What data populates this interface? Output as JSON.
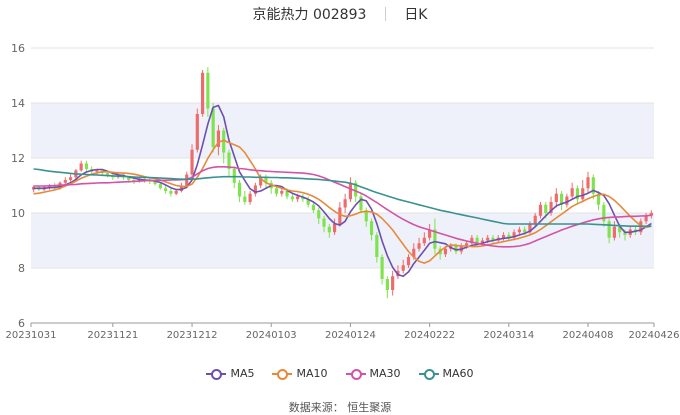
{
  "header": {
    "stock_label": "京能热力 002893",
    "period_label": "日K"
  },
  "source_text": "数据来源： 恒生聚源",
  "colors": {
    "up": "#ee6b6b",
    "down": "#7ee34c",
    "ma5": "#6d4fb0",
    "ma10": "#e8893a",
    "ma30": "#d353a6",
    "ma60": "#3a9190",
    "band": "#eef1f9"
  },
  "chart_data": {
    "type": "candlestick",
    "title": "",
    "xlabel": "",
    "ylabel": "",
    "ylim": [
      6,
      16
    ],
    "yticks": [
      6,
      8,
      10,
      12,
      14,
      16
    ],
    "grid": true,
    "legend_position": "bottom-center",
    "x_tick_labels": [
      {
        "index": 0,
        "label": "20231031"
      },
      {
        "index": 15,
        "label": "20231121"
      },
      {
        "index": 30,
        "label": "20231212"
      },
      {
        "index": 45,
        "label": "20240103"
      },
      {
        "index": 60,
        "label": "20240124"
      },
      {
        "index": 75,
        "label": "20240222"
      },
      {
        "index": 90,
        "label": "20240314"
      },
      {
        "index": 105,
        "label": "20240408"
      },
      {
        "index": 117,
        "label": "20240426"
      }
    ],
    "candles": [
      [
        10.85,
        10.95,
        10.75,
        11.0
      ],
      [
        10.95,
        10.85,
        10.8,
        11.0
      ],
      [
        10.85,
        10.95,
        10.8,
        11.0
      ],
      [
        10.95,
        11.0,
        10.85,
        11.05
      ],
      [
        11.0,
        10.9,
        10.85,
        11.1
      ],
      [
        10.9,
        11.1,
        10.85,
        11.15
      ],
      [
        11.1,
        11.2,
        11.0,
        11.3
      ],
      [
        11.2,
        11.3,
        11.1,
        11.4
      ],
      [
        11.3,
        11.55,
        11.2,
        11.6
      ],
      [
        11.55,
        11.8,
        11.5,
        11.9
      ],
      [
        11.8,
        11.6,
        11.5,
        11.9
      ],
      [
        11.6,
        11.5,
        11.4,
        11.7
      ],
      [
        11.5,
        11.55,
        11.4,
        11.6
      ],
      [
        11.55,
        11.45,
        11.35,
        11.6
      ],
      [
        11.45,
        11.35,
        11.3,
        11.5
      ],
      [
        11.35,
        11.3,
        11.2,
        11.45
      ],
      [
        11.3,
        11.4,
        11.25,
        11.5
      ],
      [
        11.4,
        11.3,
        11.2,
        11.45
      ],
      [
        11.3,
        11.2,
        11.1,
        11.35
      ],
      [
        11.2,
        11.15,
        11.05,
        11.3
      ],
      [
        11.15,
        11.25,
        11.1,
        11.3
      ],
      [
        11.25,
        11.2,
        11.1,
        11.3
      ],
      [
        11.2,
        11.15,
        11.05,
        11.3
      ],
      [
        11.15,
        11.05,
        11.0,
        11.2
      ],
      [
        11.05,
        10.9,
        10.85,
        11.1
      ],
      [
        10.9,
        10.8,
        10.7,
        11.0
      ],
      [
        10.8,
        10.7,
        10.6,
        10.9
      ],
      [
        10.7,
        10.8,
        10.65,
        10.85
      ],
      [
        10.8,
        11.0,
        10.75,
        11.1
      ],
      [
        11.0,
        11.4,
        10.9,
        11.5
      ],
      [
        11.4,
        12.3,
        11.3,
        12.5
      ],
      [
        12.3,
        13.6,
        12.2,
        13.8
      ],
      [
        13.6,
        15.1,
        13.5,
        15.2
      ],
      [
        15.1,
        13.8,
        13.5,
        15.3
      ],
      [
        13.8,
        12.4,
        12.2,
        14.0
      ],
      [
        12.4,
        13.0,
        12.1,
        13.2
      ],
      [
        13.0,
        12.2,
        11.8,
        13.1
      ],
      [
        12.2,
        11.6,
        11.3,
        12.3
      ],
      [
        11.6,
        11.1,
        10.9,
        11.7
      ],
      [
        11.1,
        10.6,
        10.4,
        11.2
      ],
      [
        10.6,
        10.4,
        10.3,
        10.8
      ],
      [
        10.4,
        10.7,
        10.3,
        10.8
      ],
      [
        10.7,
        11.0,
        10.6,
        11.1
      ],
      [
        11.0,
        11.3,
        10.9,
        11.4
      ],
      [
        11.3,
        11.1,
        10.9,
        11.4
      ],
      [
        11.1,
        10.9,
        10.7,
        11.2
      ],
      [
        10.9,
        10.7,
        10.6,
        11.0
      ],
      [
        10.7,
        10.8,
        10.6,
        10.9
      ],
      [
        10.8,
        10.6,
        10.5,
        10.9
      ],
      [
        10.6,
        10.5,
        10.4,
        10.7
      ],
      [
        10.5,
        10.6,
        10.4,
        10.7
      ],
      [
        10.6,
        10.5,
        10.4,
        10.7
      ],
      [
        10.5,
        10.3,
        10.2,
        10.6
      ],
      [
        10.3,
        10.1,
        10.0,
        10.4
      ],
      [
        10.1,
        9.8,
        9.6,
        10.2
      ],
      [
        9.8,
        9.5,
        9.3,
        9.9
      ],
      [
        9.5,
        9.3,
        9.1,
        9.6
      ],
      [
        9.3,
        9.6,
        9.2,
        9.8
      ],
      [
        9.6,
        10.2,
        9.5,
        10.4
      ],
      [
        10.2,
        10.5,
        10.0,
        10.7
      ],
      [
        10.5,
        11.1,
        10.4,
        11.3
      ],
      [
        11.1,
        10.6,
        10.4,
        11.2
      ],
      [
        10.6,
        10.1,
        10.0,
        10.7
      ],
      [
        10.1,
        9.7,
        9.5,
        10.2
      ],
      [
        9.7,
        9.2,
        9.0,
        9.8
      ],
      [
        9.2,
        8.4,
        8.2,
        9.3
      ],
      [
        8.4,
        7.6,
        7.4,
        8.5
      ],
      [
        7.6,
        7.2,
        6.9,
        7.7
      ],
      [
        7.2,
        7.7,
        7.0,
        7.9
      ],
      [
        7.7,
        7.9,
        7.6,
        8.1
      ],
      [
        7.9,
        8.1,
        7.8,
        8.3
      ],
      [
        8.1,
        8.4,
        8.0,
        8.5
      ],
      [
        8.4,
        8.7,
        8.3,
        8.9
      ],
      [
        8.7,
        8.9,
        8.6,
        9.1
      ],
      [
        8.9,
        9.1,
        8.8,
        9.3
      ],
      [
        9.1,
        9.4,
        9.0,
        9.6
      ],
      [
        9.4,
        8.7,
        8.5,
        9.8
      ],
      [
        8.7,
        8.5,
        8.3,
        8.8
      ],
      [
        8.5,
        8.7,
        8.4,
        8.8
      ],
      [
        8.7,
        8.8,
        8.6,
        8.9
      ],
      [
        8.8,
        8.6,
        8.5,
        8.9
      ],
      [
        8.6,
        8.8,
        8.5,
        8.9
      ],
      [
        8.8,
        8.9,
        8.7,
        9.0
      ],
      [
        8.9,
        9.1,
        8.8,
        9.2
      ],
      [
        9.1,
        8.9,
        8.8,
        9.2
      ],
      [
        8.9,
        9.0,
        8.8,
        9.1
      ],
      [
        9.0,
        9.1,
        8.9,
        9.2
      ],
      [
        9.1,
        9.0,
        8.9,
        9.2
      ],
      [
        9.0,
        9.1,
        8.9,
        9.2
      ],
      [
        9.1,
        9.2,
        9.0,
        9.3
      ],
      [
        9.2,
        9.1,
        9.0,
        9.3
      ],
      [
        9.1,
        9.3,
        9.0,
        9.4
      ],
      [
        9.3,
        9.4,
        9.2,
        9.5
      ],
      [
        9.4,
        9.3,
        9.2,
        9.5
      ],
      [
        9.3,
        9.6,
        9.2,
        9.7
      ],
      [
        9.6,
        9.9,
        9.5,
        10.0
      ],
      [
        9.9,
        10.3,
        9.8,
        10.4
      ],
      [
        10.3,
        10.0,
        9.8,
        10.4
      ],
      [
        10.0,
        10.4,
        9.9,
        10.6
      ],
      [
        10.4,
        10.7,
        10.2,
        10.9
      ],
      [
        10.7,
        10.3,
        10.1,
        10.8
      ],
      [
        10.3,
        10.6,
        10.2,
        10.7
      ],
      [
        10.6,
        10.9,
        10.5,
        11.1
      ],
      [
        10.9,
        10.5,
        10.3,
        11.0
      ],
      [
        10.5,
        10.9,
        10.4,
        11.2
      ],
      [
        10.9,
        11.3,
        10.7,
        11.5
      ],
      [
        11.3,
        10.7,
        10.5,
        11.4
      ],
      [
        10.7,
        10.3,
        10.1,
        10.8
      ],
      [
        10.3,
        9.7,
        9.5,
        10.4
      ],
      [
        9.7,
        9.1,
        8.9,
        9.8
      ],
      [
        9.1,
        9.5,
        9.0,
        9.7
      ],
      [
        9.5,
        9.3,
        9.1,
        9.6
      ],
      [
        9.3,
        9.2,
        9.0,
        9.4
      ],
      [
        9.2,
        9.4,
        9.1,
        9.5
      ],
      [
        9.4,
        9.3,
        9.2,
        9.5
      ],
      [
        9.3,
        9.7,
        9.2,
        9.8
      ],
      [
        9.7,
        9.9,
        9.6,
        10.0
      ],
      [
        9.9,
        10.0,
        9.8,
        10.1
      ]
    ],
    "series": [
      {
        "name": "MA5",
        "color": "#6d4fb0",
        "values": [
          10.9,
          10.9,
          10.9,
          10.92,
          10.93,
          10.96,
          11.02,
          11.1,
          11.22,
          11.39,
          11.49,
          11.55,
          11.58,
          11.58,
          11.52,
          11.44,
          11.39,
          11.36,
          11.31,
          11.27,
          11.22,
          11.2,
          11.19,
          11.16,
          11.11,
          11.02,
          10.92,
          10.85,
          10.86,
          10.94,
          11.2,
          11.76,
          12.48,
          13.24,
          13.84,
          13.91,
          13.5,
          12.64,
          12.06,
          11.5,
          11.18,
          10.88,
          10.76,
          10.8,
          10.9,
          11.0,
          11.0,
          10.96,
          10.82,
          10.72,
          10.64,
          10.58,
          10.5,
          10.4,
          10.26,
          10.04,
          9.8,
          9.62,
          9.56,
          9.7,
          10.04,
          10.3,
          10.5,
          10.44,
          10.14,
          9.62,
          8.98,
          8.44,
          8.02,
          7.76,
          7.7,
          7.86,
          8.16,
          8.4,
          8.64,
          8.9,
          8.96,
          8.92,
          8.88,
          8.74,
          8.66,
          8.68,
          8.76,
          8.82,
          8.86,
          8.9,
          8.96,
          9.0,
          9.04,
          9.08,
          9.1,
          9.14,
          9.2,
          9.26,
          9.34,
          9.5,
          9.7,
          9.9,
          10.08,
          10.26,
          10.34,
          10.4,
          10.5,
          10.6,
          10.64,
          10.72,
          10.82,
          10.74,
          10.64,
          10.34,
          9.92,
          9.52,
          9.3,
          9.3,
          9.34,
          9.38,
          9.5,
          9.62
        ]
      },
      {
        "name": "MA10",
        "color": "#e8893a",
        "values": [
          10.7,
          10.72,
          10.76,
          10.8,
          10.84,
          10.9,
          10.98,
          11.06,
          11.16,
          11.26,
          11.34,
          11.41,
          11.46,
          11.5,
          11.5,
          11.48,
          11.46,
          11.45,
          11.44,
          11.41,
          11.37,
          11.32,
          11.28,
          11.25,
          11.2,
          11.13,
          11.06,
          11.0,
          10.97,
          10.97,
          11.05,
          11.3,
          11.62,
          11.99,
          12.3,
          12.57,
          12.64,
          12.56,
          12.48,
          12.4,
          12.2,
          11.9,
          11.6,
          11.26,
          11.1,
          11.02,
          10.96,
          10.9,
          10.84,
          10.8,
          10.78,
          10.74,
          10.68,
          10.6,
          10.5,
          10.36,
          10.2,
          10.06,
          9.94,
          9.88,
          9.9,
          9.96,
          10.04,
          10.06,
          10.04,
          9.96,
          9.8,
          9.6,
          9.38,
          9.12,
          8.86,
          8.6,
          8.4,
          8.24,
          8.18,
          8.26,
          8.44,
          8.62,
          8.76,
          8.84,
          8.82,
          8.8,
          8.8,
          8.78,
          8.78,
          8.8,
          8.84,
          8.88,
          8.92,
          8.96,
          9.0,
          9.04,
          9.08,
          9.14,
          9.2,
          9.28,
          9.4,
          9.54,
          9.68,
          9.82,
          9.96,
          10.1,
          10.24,
          10.34,
          10.42,
          10.52,
          10.6,
          10.66,
          10.68,
          10.6,
          10.46,
          10.28,
          10.08,
          9.88,
          9.7,
          9.54,
          9.48,
          9.52
        ]
      },
      {
        "name": "MA30",
        "color": "#d353a6",
        "values": [
          10.98,
          10.98,
          10.98,
          10.99,
          11.0,
          11.01,
          11.02,
          11.03,
          11.04,
          11.06,
          11.07,
          11.08,
          11.09,
          11.1,
          11.1,
          11.11,
          11.12,
          11.13,
          11.14,
          11.15,
          11.16,
          11.17,
          11.18,
          11.18,
          11.19,
          11.19,
          11.2,
          11.2,
          11.21,
          11.22,
          11.3,
          11.42,
          11.54,
          11.62,
          11.66,
          11.68,
          11.68,
          11.67,
          11.65,
          11.62,
          11.6,
          11.57,
          11.55,
          11.54,
          11.52,
          11.51,
          11.5,
          11.49,
          11.48,
          11.47,
          11.46,
          11.45,
          11.43,
          11.4,
          11.35,
          11.28,
          11.2,
          11.12,
          11.04,
          10.96,
          10.88,
          10.8,
          10.72,
          10.62,
          10.5,
          10.38,
          10.25,
          10.12,
          10.0,
          9.88,
          9.77,
          9.67,
          9.58,
          9.5,
          9.44,
          9.38,
          9.32,
          9.26,
          9.2,
          9.14,
          9.08,
          9.03,
          8.98,
          8.94,
          8.9,
          8.86,
          8.83,
          8.8,
          8.78,
          8.77,
          8.77,
          8.78,
          8.8,
          8.84,
          8.9,
          8.98,
          9.06,
          9.14,
          9.22,
          9.3,
          9.38,
          9.45,
          9.52,
          9.58,
          9.64,
          9.7,
          9.75,
          9.79,
          9.82,
          9.84,
          9.85,
          9.86,
          9.87,
          9.88,
          9.88,
          9.89,
          9.9,
          9.92
        ]
      },
      {
        "name": "MA60",
        "color": "#3a9190",
        "values": [
          11.6,
          11.58,
          11.55,
          11.52,
          11.5,
          11.48,
          11.46,
          11.44,
          11.42,
          11.41,
          11.4,
          11.39,
          11.38,
          11.37,
          11.36,
          11.35,
          11.34,
          11.33,
          11.32,
          11.31,
          11.3,
          11.3,
          11.29,
          11.28,
          11.27,
          11.26,
          11.25,
          11.24,
          11.23,
          11.23,
          11.23,
          11.24,
          11.26,
          11.28,
          11.3,
          11.31,
          11.32,
          11.32,
          11.32,
          11.32,
          11.31,
          11.31,
          11.3,
          11.3,
          11.3,
          11.29,
          11.29,
          11.28,
          11.28,
          11.27,
          11.26,
          11.25,
          11.24,
          11.23,
          11.22,
          11.2,
          11.18,
          11.16,
          11.14,
          11.12,
          11.08,
          11.02,
          10.95,
          10.88,
          10.81,
          10.74,
          10.68,
          10.62,
          10.56,
          10.5,
          10.45,
          10.4,
          10.35,
          10.3,
          10.25,
          10.2,
          10.15,
          10.1,
          10.06,
          10.02,
          9.98,
          9.94,
          9.9,
          9.86,
          9.82,
          9.78,
          9.74,
          9.7,
          9.66,
          9.62,
          9.6,
          9.6,
          9.6,
          9.6,
          9.6,
          9.6,
          9.6,
          9.6,
          9.6,
          9.6,
          9.6,
          9.6,
          9.6,
          9.6,
          9.6,
          9.6,
          9.59,
          9.58,
          9.57,
          9.56,
          9.55,
          9.54,
          9.53,
          9.52,
          9.52,
          9.52,
          9.52,
          9.52
        ]
      }
    ]
  }
}
